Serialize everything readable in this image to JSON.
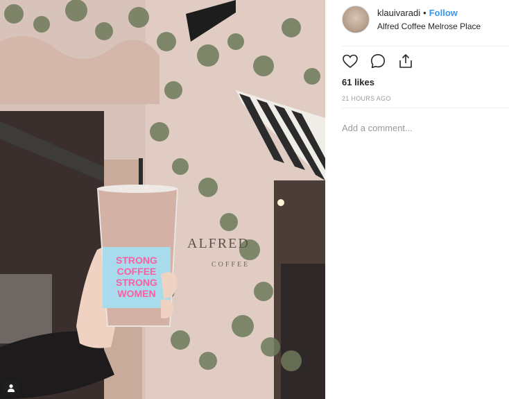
{
  "post": {
    "username": "klauivaradi",
    "separator": "•",
    "follow_label": "Follow",
    "location": "Alfred Coffee Melrose Place",
    "likes": "61 likes",
    "timestamp": "21 HOURS AGO",
    "comment_placeholder": "Add a comment..."
  },
  "photo": {
    "shop_sign": "ALFRED",
    "sign_sub": "COFFEE",
    "cup_text": [
      "STRONG",
      "COFFEE",
      "STRONG",
      "WOMEN"
    ]
  },
  "icons": {
    "like": "heart-icon",
    "comment": "comment-bubble-icon",
    "share": "share-icon",
    "user_tag": "user-tag-icon"
  },
  "colors": {
    "follow": "#3897f0",
    "text": "#262626",
    "muted": "#999999"
  }
}
